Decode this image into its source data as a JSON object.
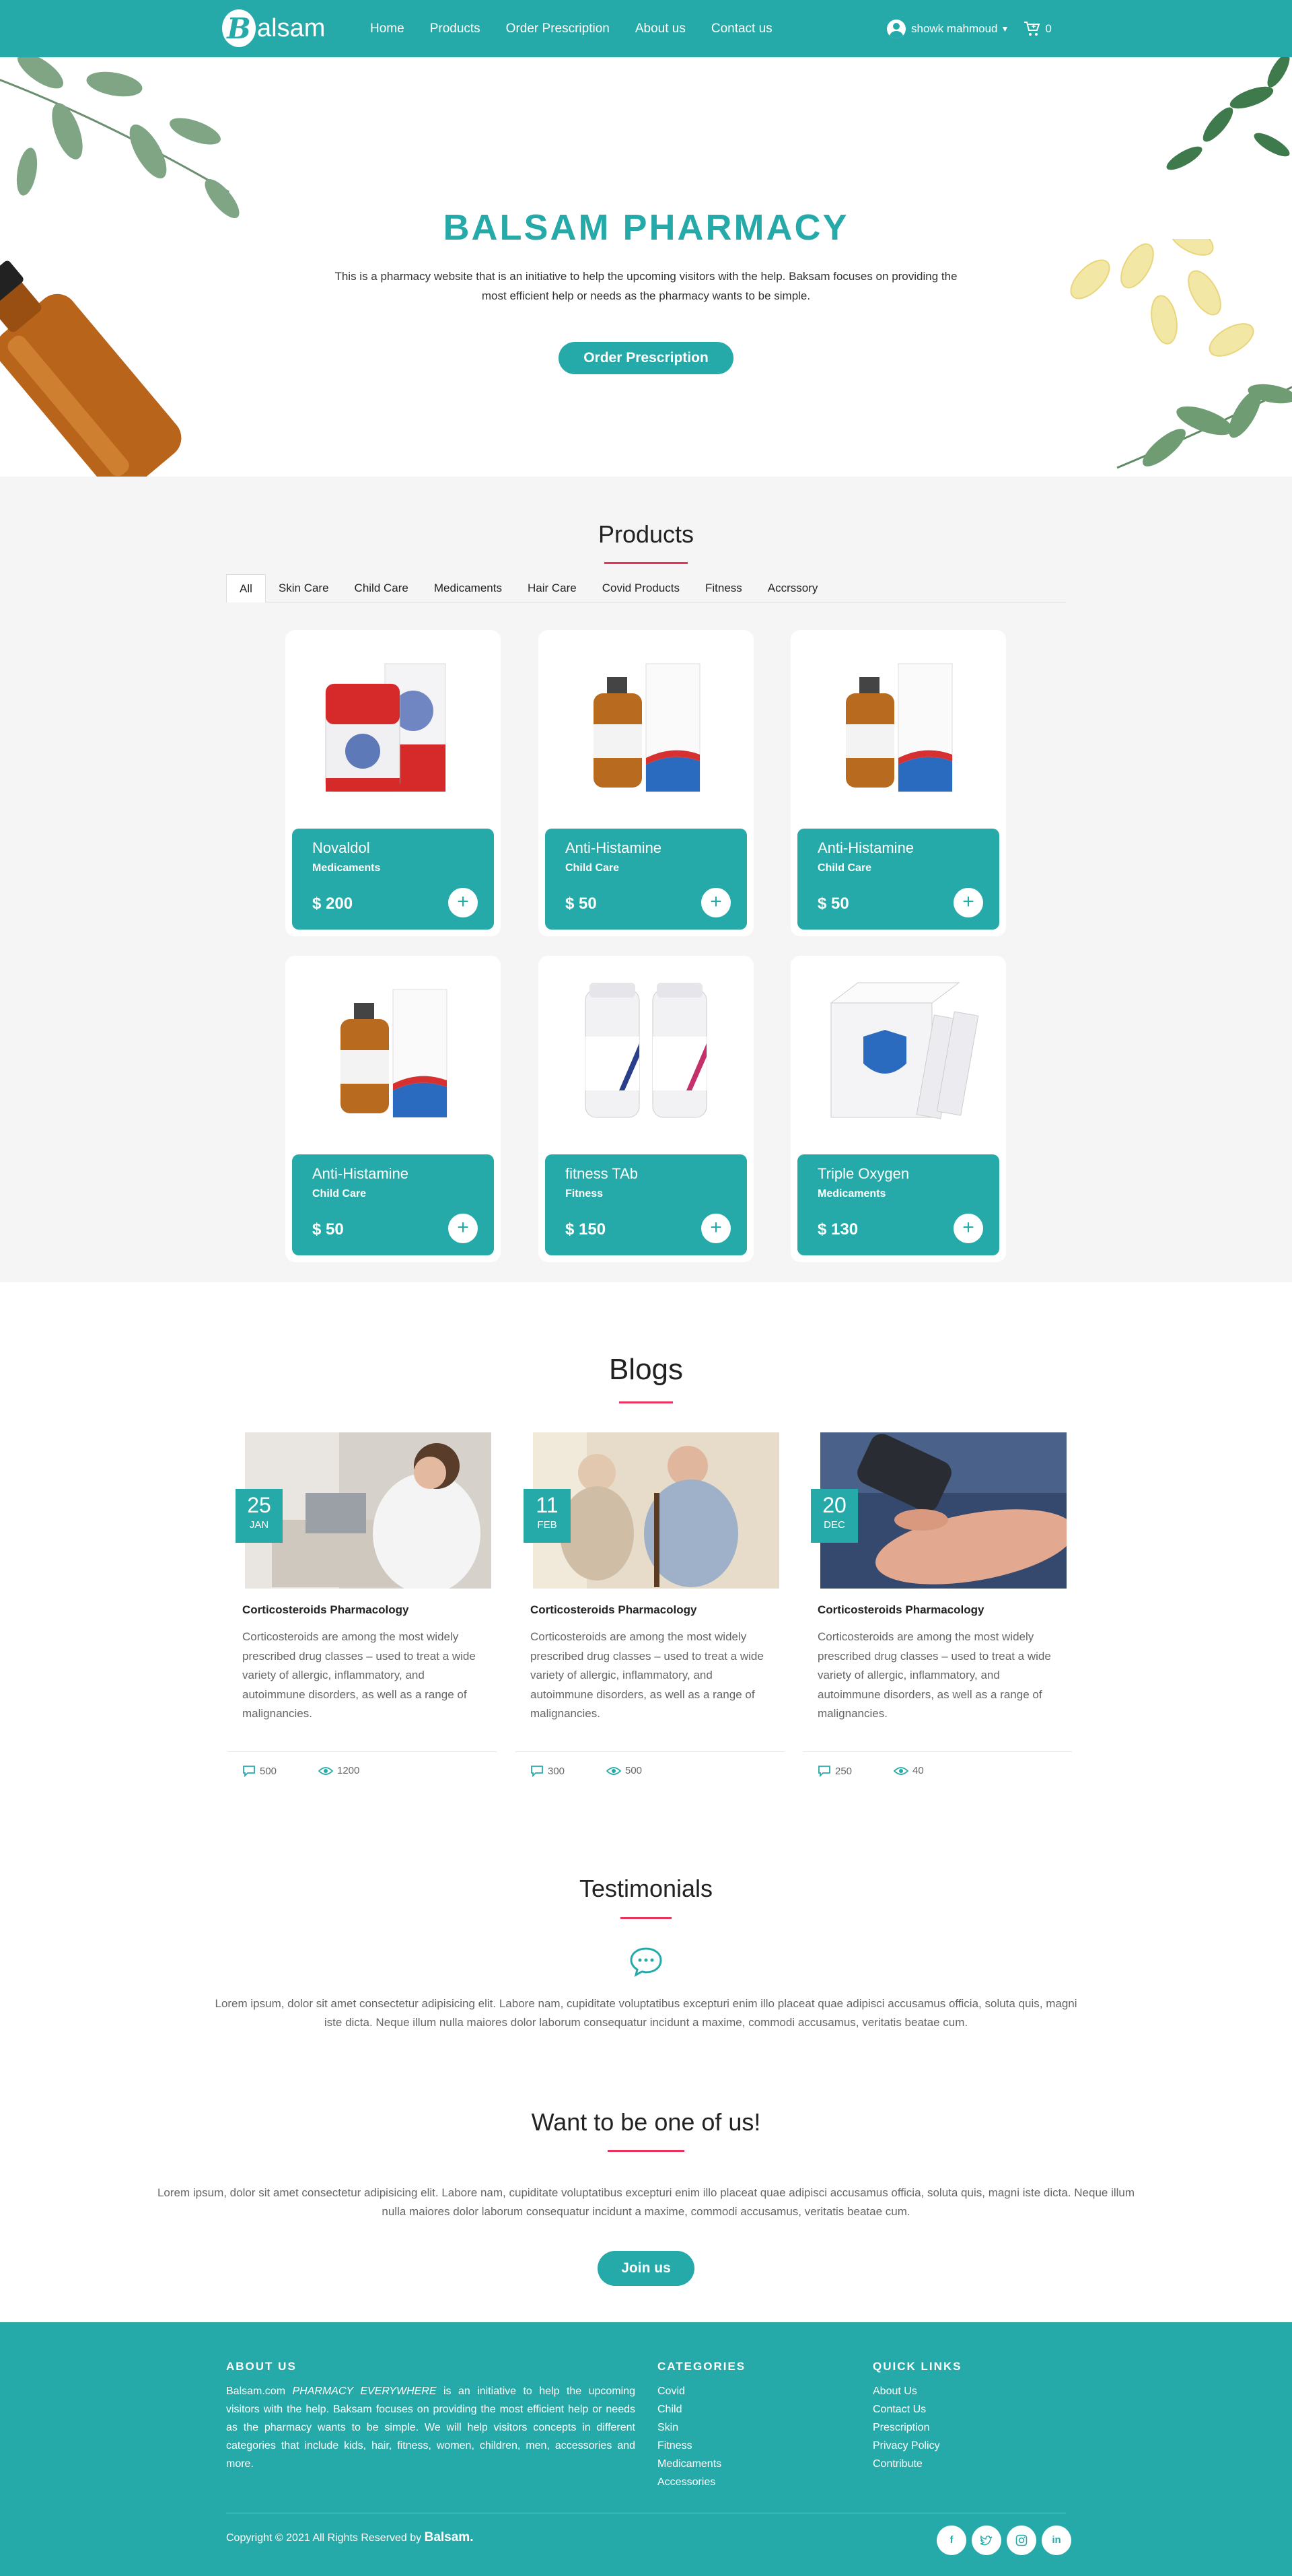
{
  "colors": {
    "accent": "#26aaa9",
    "underline": "#e8335c"
  },
  "brand": {
    "logo_letter": "B",
    "logo_text": "alsam"
  },
  "nav": {
    "links": [
      "Home",
      "Products",
      "Order Prescription",
      "About us",
      "Contact us"
    ],
    "user_name": "showk mahmoud",
    "cart_count": "0"
  },
  "hero": {
    "title": "BALSAM PHARMACY",
    "description": "This is a pharmacy website that is an initiative to help the upcoming visitors with the help. Baksam focuses on providing the most efficient help or needs as the pharmacy wants to be simple.",
    "button": "Order Prescription"
  },
  "products": {
    "title": "Products",
    "filters": [
      "All",
      "Skin Care",
      "Child Care",
      "Medicaments",
      "Hair Care",
      "Covid Products",
      "Fitness",
      "Accrssory"
    ],
    "active_filter": "All",
    "items": [
      {
        "name": "Novaldol",
        "category": "Medicaments",
        "price": "$ 200"
      },
      {
        "name": "Anti-Histamine",
        "category": "Child Care",
        "price": "$ 50"
      },
      {
        "name": "Anti-Histamine",
        "category": "Child Care",
        "price": "$ 50"
      },
      {
        "name": "Anti-Histamine",
        "category": "Child Care",
        "price": "$ 50"
      },
      {
        "name": "fitness TAb",
        "category": "Fitness",
        "price": "$ 150"
      },
      {
        "name": "Triple Oxygen",
        "category": "Medicaments",
        "price": "$ 130"
      }
    ]
  },
  "blogs": {
    "title": "Blogs",
    "items": [
      {
        "day": "25",
        "month": "JAN",
        "title": "Corticosteroids Pharmacology",
        "text": "Corticosteroids are among the most widely prescribed drug classes – used to treat a wide variety of allergic, inflammatory, and autoimmune disorders, as well as a range of malignancies.",
        "comments": "500",
        "views": "1200"
      },
      {
        "day": "11",
        "month": "FEB",
        "title": "Corticosteroids Pharmacology",
        "text": "Corticosteroids are among the most widely prescribed drug classes – used to treat a wide variety of allergic, inflammatory, and autoimmune disorders, as well as a range of malignancies.",
        "comments": "300",
        "views": "500"
      },
      {
        "day": "20",
        "month": "DEC",
        "title": "Corticosteroids Pharmacology",
        "text": "Corticosteroids are among the most widely prescribed drug classes – used to treat a wide variety of allergic, inflammatory, and autoimmune disorders, as well as a range of malignancies.",
        "comments": "250",
        "views": "40"
      }
    ]
  },
  "testimonials": {
    "title": "Testimonials",
    "text": "Lorem ipsum, dolor sit amet consectetur adipisicing elit. Labore nam, cupiditate voluptatibus excepturi enim illo placeat quae adipisci accusamus officia, soluta quis, magni iste dicta. Neque illum nulla maiores dolor laborum consequatur incidunt a maxime, commodi accusamus, veritatis beatae cum."
  },
  "join": {
    "title": "Want to be one of us!",
    "text": "Lorem ipsum, dolor sit amet consectetur adipisicing elit. Labore nam, cupiditate voluptatibus excepturi enim illo placeat quae adipisci accusamus officia, soluta quis, magni iste dicta. Neque illum nulla maiores dolor laborum consequatur incidunt a maxime, commodi accusamus, veritatis beatae cum.",
    "button": "Join us"
  },
  "footer": {
    "about_heading": "ABOUT US",
    "about_brand": "Balsam.com",
    "about_tagline": "PHARMACY EVERYWHERE",
    "about_text": "is an initiative to help the upcoming visitors with the help. Baksam focuses on providing the most efficient help or needs as the pharmacy wants to be simple. We will help visitors concepts in different categories that include kids, hair, fitness, women, children, men, accessories and more.",
    "categories_heading": "CATEGORIES",
    "categories": [
      "Covid",
      "Child",
      "Skin",
      "Fitness",
      "Medicaments",
      "Accessories"
    ],
    "links_heading": "QUICK LINKS",
    "links": [
      "About Us",
      "Contact Us",
      "Prescription",
      "Privacy Policy",
      "Contribute"
    ],
    "copyright": "Copyright © 2021 All Rights Reserved by",
    "copyright_brand": "Balsam.",
    "socials": [
      "facebook-icon",
      "twitter-icon",
      "instagram-icon",
      "linkedin-icon"
    ]
  }
}
